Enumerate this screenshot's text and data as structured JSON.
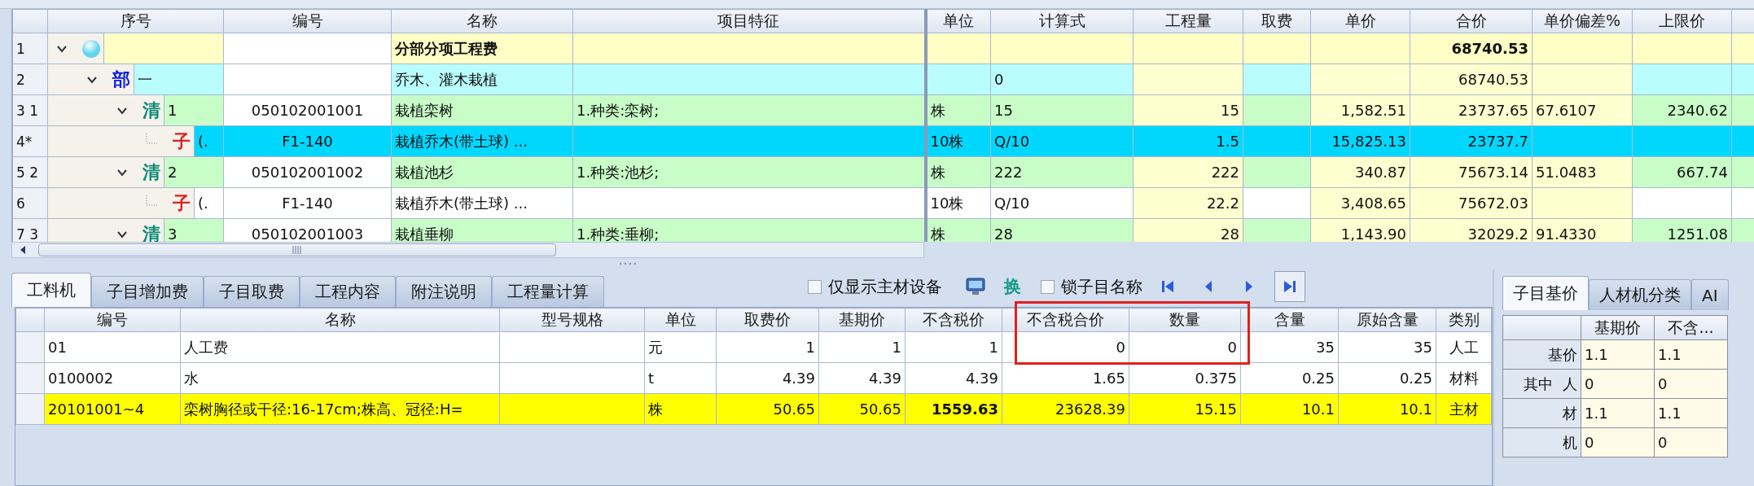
{
  "top_grid": {
    "columns": [
      "序号",
      "编号",
      "名称",
      "项目特征",
      "单位",
      "计算式",
      "工程量",
      "取费",
      "单价",
      "合价",
      "单价偏差%",
      "上限价"
    ],
    "rows": [
      {
        "number": "1",
        "kind": "root",
        "expanded": true,
        "selected": false,
        "cells": [
          null,
          null,
          "分部分项工程费",
          null,
          null,
          null,
          null,
          null,
          null,
          "68740.53",
          null,
          null
        ],
        "children": [
          {
            "number": "2",
            "kind": "section",
            "marker": "部",
            "expanded": true,
            "selected": false,
            "cells": [
              "一",
              null,
              "乔木、灌木栽植",
              null,
              null,
              "0",
              null,
              null,
              null,
              "68740.53",
              null,
              null
            ],
            "children": [
              {
                "number": "3 1",
                "kind": "item",
                "marker": "清",
                "expanded": true,
                "selected": false,
                "cells": [
                  "1",
                  "050102001001",
                  "栽植栾树",
                  "1.种类:栾树;",
                  "株",
                  "15",
                  "15",
                  null,
                  "1,582.51",
                  "23737.65",
                  "67.6107",
                  "2340.62"
                ],
                "children": [
                  {
                    "number": "4*",
                    "kind": "sub",
                    "marker": "子",
                    "selected": true,
                    "cells": [
                      "(.",
                      "F1-140",
                      "栽植乔木(带土球) ...",
                      null,
                      "10株",
                      "Q/10",
                      "1.5",
                      null,
                      "15,825.13",
                      "23737.7",
                      null,
                      null
                    ]
                  }
                ]
              },
              {
                "number": "5 2",
                "kind": "item",
                "marker": "清",
                "expanded": true,
                "selected": false,
                "cells": [
                  "2",
                  "050102001002",
                  "栽植池杉",
                  "1.种类:池杉;",
                  "株",
                  "222",
                  "222",
                  null,
                  "340.87",
                  "75673.14",
                  "51.0483",
                  "667.74"
                ],
                "children": [
                  {
                    "number": "6",
                    "kind": "sub",
                    "marker": "子",
                    "selected": false,
                    "cells": [
                      "(.",
                      "F1-140",
                      "栽植乔木(带土球) ...",
                      null,
                      "10株",
                      "Q/10",
                      "22.2",
                      null,
                      "3,408.65",
                      "75672.03",
                      null,
                      null
                    ]
                  }
                ]
              },
              {
                "number": "7 3",
                "kind": "item",
                "marker": "清",
                "expanded": true,
                "selected": false,
                "cells": [
                  "3",
                  "050102001003",
                  "栽植垂柳",
                  "1.种类:垂柳;",
                  "株",
                  "28",
                  "28",
                  null,
                  "1,143.90",
                  "32029.2",
                  "91.4330",
                  "1251.08"
                ]
              }
            ]
          }
        ]
      }
    ]
  },
  "detail": {
    "tabs": [
      {
        "label": "工料机",
        "selected": true
      },
      {
        "label": "子目增加费",
        "selected": false
      },
      {
        "label": "子目取费",
        "selected": false
      },
      {
        "label": "工程内容",
        "selected": false
      },
      {
        "label": "附注说明",
        "selected": false
      },
      {
        "label": "工程量计算",
        "selected": false
      }
    ],
    "main_only": {
      "label": "仅显示主材设备",
      "checked": false
    },
    "swap_label": "换",
    "lock_name": {
      "label": "锁子目名称",
      "checked": false
    },
    "nav": [
      {
        "kind": "first",
        "pressed": false
      },
      {
        "kind": "prev",
        "pressed": false
      },
      {
        "kind": "next",
        "pressed": false
      },
      {
        "kind": "last",
        "pressed": true
      }
    ],
    "annotation": {
      "kind": "red_frame"
    },
    "grid": {
      "columns": [
        "编号",
        "名称",
        "型号规格",
        "单位",
        "取费价",
        "基期价",
        "不含税价",
        "不含税合价",
        "数量",
        "含量",
        "原始含量",
        "类别"
      ],
      "rows": [
        {
          "selected": false,
          "cells": [
            "01",
            "人工费",
            null,
            "元",
            "1",
            "1",
            "1",
            "0",
            "0",
            "35",
            "35",
            "人工"
          ]
        },
        {
          "selected": false,
          "cells": [
            "0100002",
            "水",
            null,
            "t",
            "4.39",
            "4.39",
            "4.39",
            "1.65",
            "0.375",
            "0.25",
            "0.25",
            "材料"
          ]
        },
        {
          "selected": true,
          "cells": [
            "20101001~4",
            "栾树胸径或干径:16-17cm;株高、冠径:H=",
            null,
            "株",
            "50.65",
            "50.65",
            "1559.63",
            "23628.39",
            "15.15",
            "10.1",
            "10.1",
            "主材"
          ]
        }
      ]
    }
  },
  "side": {
    "tabs": [
      {
        "label": "子目基价",
        "selected": true
      },
      {
        "label": "人材机分类",
        "selected": false
      },
      {
        "label": "AI",
        "selected": false
      }
    ],
    "columns": [
      "基期价",
      "不含..."
    ],
    "rows": [
      {
        "label": "基价",
        "values": [
          "1.1",
          "1.1"
        ]
      },
      {
        "group": "其中",
        "label": "人",
        "values": [
          "0",
          "0"
        ]
      },
      {
        "label": "材",
        "values": [
          "1.1",
          "1.1"
        ]
      },
      {
        "label": "机",
        "values": [
          "0",
          "0"
        ]
      }
    ]
  }
}
